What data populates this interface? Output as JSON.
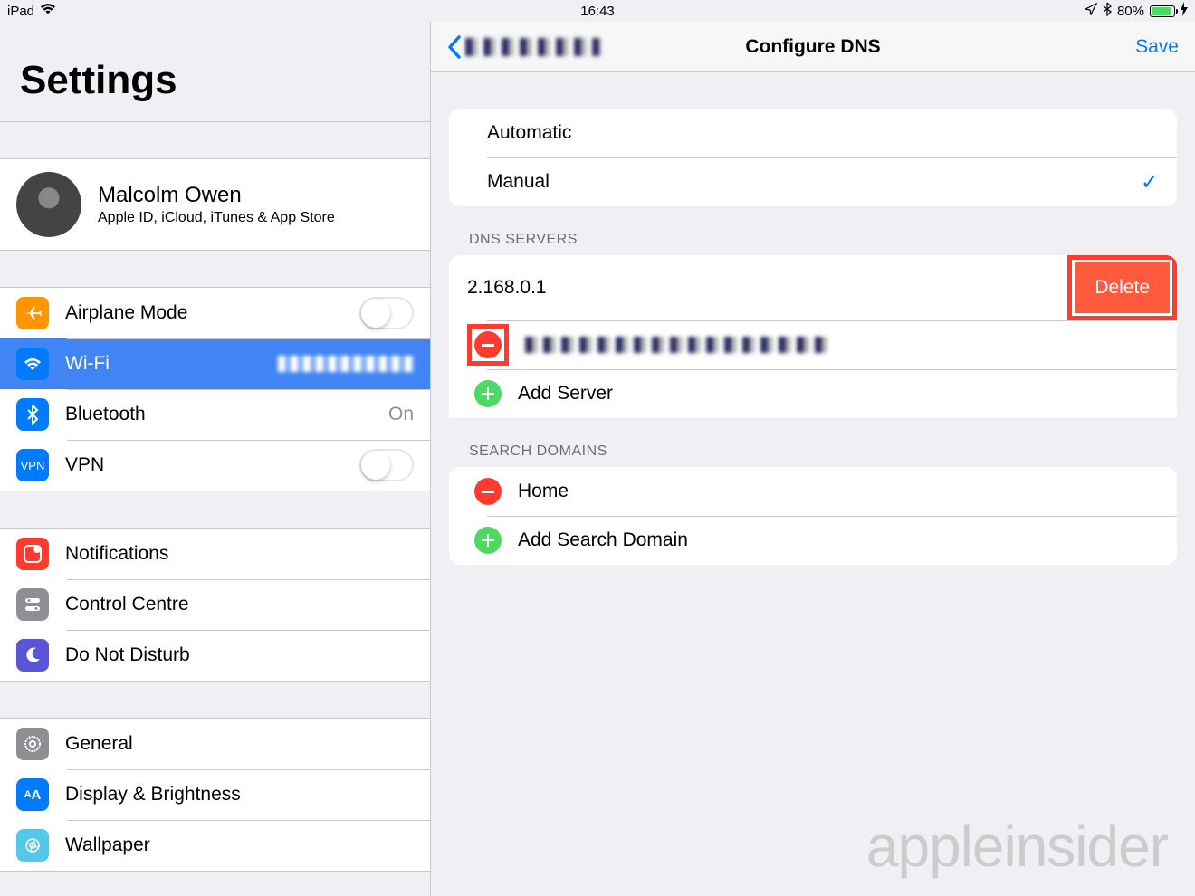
{
  "statusbar": {
    "device": "iPad",
    "time": "16:43",
    "battery_pct": "80%"
  },
  "sidebar": {
    "title": "Settings",
    "profile": {
      "name": "Malcolm Owen",
      "sub": "Apple ID, iCloud, iTunes & App Store"
    },
    "items": {
      "airplane": "Airplane Mode",
      "wifi": "Wi-Fi",
      "wifi_value": "██████",
      "bluetooth": "Bluetooth",
      "bluetooth_value": "On",
      "vpn": "VPN",
      "notifications": "Notifications",
      "control": "Control Centre",
      "dnd": "Do Not Disturb",
      "general": "General",
      "display": "Display & Brightness",
      "wallpaper": "Wallpaper"
    }
  },
  "detail": {
    "back_label": "██████",
    "title": "Configure DNS",
    "save": "Save",
    "mode": {
      "auto": "Automatic",
      "manual": "Manual"
    },
    "dns_header": "DNS SERVERS",
    "dns_row1_ip": "2.168.0.1",
    "dns_row1_delete": "Delete",
    "dns_row2_ip": "██████",
    "add_server": "Add Server",
    "search_header": "SEARCH DOMAINS",
    "search_row1": "Home",
    "add_search": "Add Search Domain"
  },
  "watermark": "appleinsider"
}
